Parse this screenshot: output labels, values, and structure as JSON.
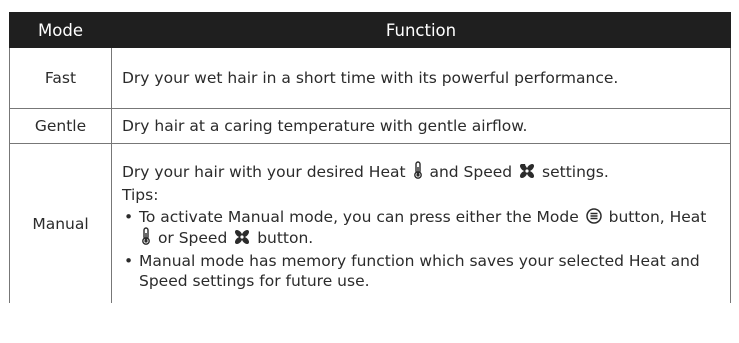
{
  "table": {
    "headers": {
      "mode": "Mode",
      "function": "Function"
    },
    "rows": {
      "fast": {
        "mode": "Fast",
        "function": "Dry your wet hair in a short time with its powerful performance."
      },
      "gentle": {
        "mode": "Gentle",
        "function": "Dry hair at a caring temperature with gentle airflow."
      },
      "manual": {
        "mode": "Manual",
        "intro": {
          "part1": "Dry your hair with your desired Heat",
          "part2": "and Speed",
          "part3": "settings."
        },
        "tips_label": "Tips:",
        "tip1": {
          "part1": "To activate Manual mode, you can press either the Mode",
          "part2": "button, Heat",
          "part3": "or Speed",
          "part4": "button."
        },
        "tip2": "Manual mode has memory function which saves your selected Heat and Speed settings for future use."
      }
    }
  },
  "icons": {
    "heat": "thermometer-icon",
    "speed": "fan-icon",
    "mode": "mode-menu-icon"
  },
  "colors": {
    "header_bg": "#1f1f1f",
    "header_text": "#ffffff",
    "border": "#777777",
    "body_text": "#2b2b2b"
  }
}
